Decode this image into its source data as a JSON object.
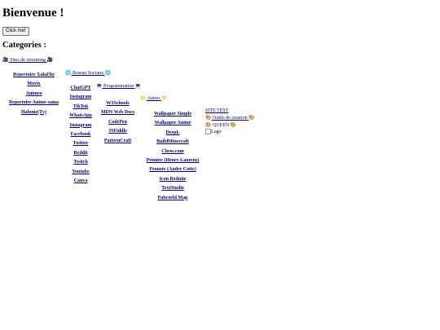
{
  "title": "Bienvenue !",
  "button_label": "Click me!",
  "categories_heading": "Categories :",
  "streaming": {
    "label": "Sites de streaming",
    "icon": "🎥",
    "items": [
      "Repertoire XalaFlix",
      "Movix",
      "Animeo",
      "Repertoire Anime-sama",
      "Halonie(Tv)"
    ]
  },
  "social": {
    "label": "Reseau Sociaux",
    "icon": "🌐",
    "items": [
      "ChatGPT",
      "Instagram",
      "TikTok",
      "WhatsApp",
      "Instagram",
      "Facebook",
      "Twitter",
      "Reddit",
      "Twitch",
      "Youtube",
      "Canva"
    ]
  },
  "programming": {
    "label": "Programmation",
    "icon": "💻",
    "items": [
      "W3Schools",
      "MDN Web Docs",
      "CodePen",
      "JSFiddle",
      "PatternCraft"
    ]
  },
  "others": {
    "label": "Autres",
    "icon": "📁",
    "items": [
      "Wallpaper Simple",
      "Wallpaper Animé",
      "DeepL",
      "BuildMinecraft",
      "Chess.com",
      "Pronote (Henry Laurens)",
      "Pronote (Andre Cotte)",
      "Icon Reduite",
      "TextStudio",
      "Palworld Map"
    ]
  },
  "misc": {
    "site_test": "SITE TEST",
    "tools_label": "Outils de creation",
    "tools_icon": "🎨",
    "queen_label": "QUEEN",
    "queen_icon": "🎨",
    "logo_alt": "Logo"
  }
}
